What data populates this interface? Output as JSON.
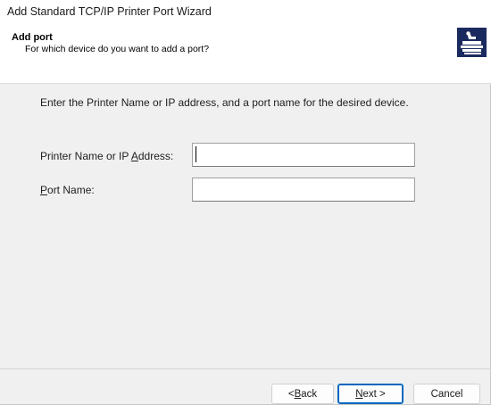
{
  "window": {
    "title": "Add Standard TCP/IP Printer Port Wizard"
  },
  "header": {
    "title": "Add port",
    "subtitle": "For which device do you want to add a port?",
    "icon": "printer-wizard-icon"
  },
  "main": {
    "instruction": "Enter the Printer Name or IP address, and a port name for the desired device.",
    "printer_field": {
      "label_pre": "Printer Name or IP ",
      "label_accel": "A",
      "label_post": "ddress:",
      "value": "",
      "placeholder": ""
    },
    "port_field": {
      "label_accel": "P",
      "label_post": "ort Name:",
      "value": "",
      "placeholder": ""
    }
  },
  "footer": {
    "back_pre": "< ",
    "back_accel": "B",
    "back_post": "ack",
    "next_accel": "N",
    "next_post": "ext >",
    "cancel_label": "Cancel"
  },
  "colors": {
    "header_icon_bg": "#1b2a5e",
    "default_button_border": "#0067c0"
  }
}
